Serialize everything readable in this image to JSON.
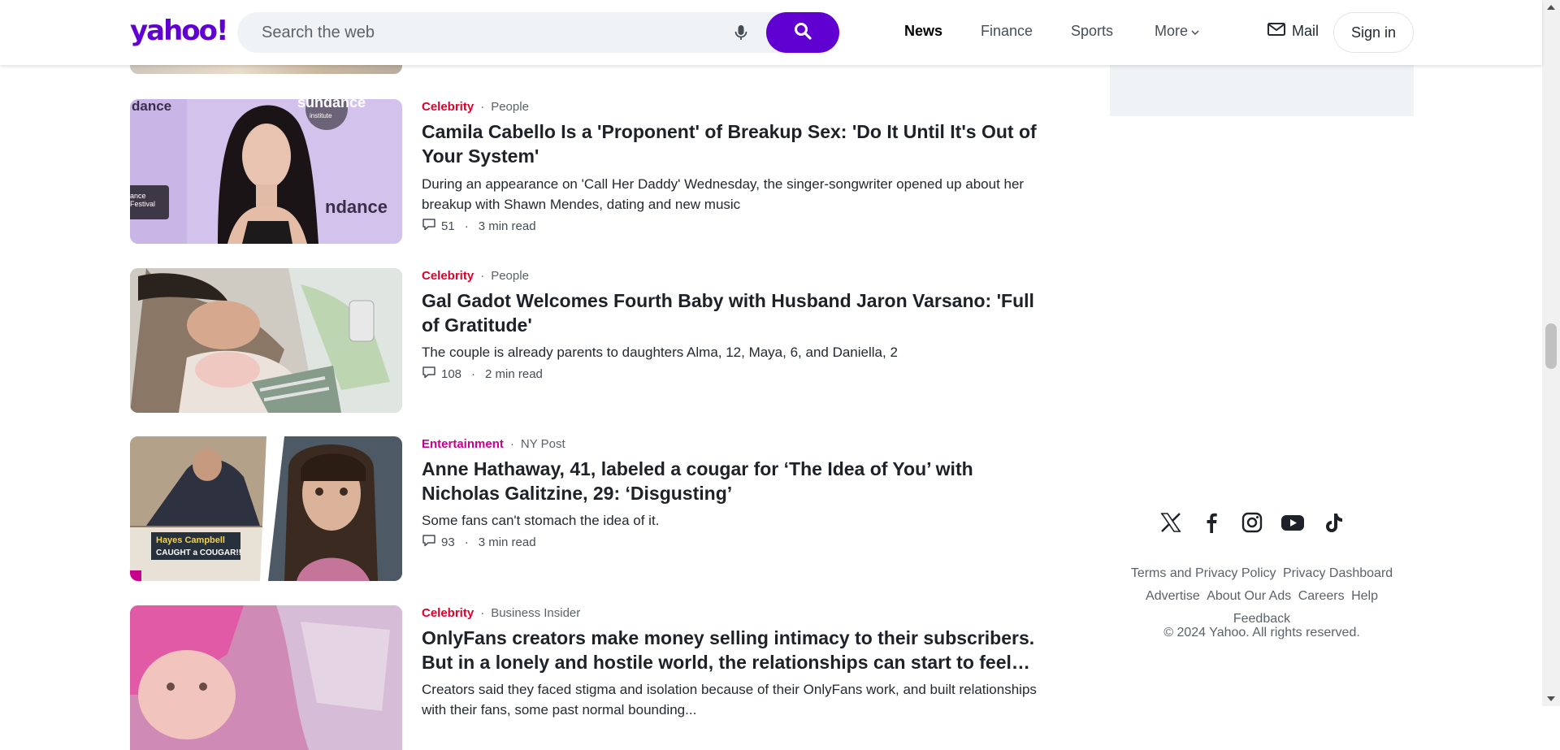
{
  "header": {
    "logo": "yahoo!",
    "search_placeholder": "Search the web",
    "nav": [
      "News",
      "Finance",
      "Sports",
      "More"
    ],
    "mail_label": "Mail",
    "signin_label": "Sign in"
  },
  "stream": [
    {
      "category": "Celebrity",
      "category_color": "#e0002b",
      "source": "People",
      "title": "Camila Cabello Is a 'Proponent' of Breakup Sex: 'Do It Until It's Out of Your System'",
      "summary": "During an appearance on 'Call Her Daddy' Wednesday, the singer-songwriter opened up about her breakup with Shawn Mendes, dating and new music",
      "comments": "51",
      "read_time": "3 min read",
      "thumb_text": [
        "dance",
        "sundance",
        "institute",
        "ance",
        "Festival",
        "ndance"
      ]
    },
    {
      "category": "Celebrity",
      "category_color": "#e0002b",
      "source": "People",
      "title": "Gal Gadot Welcomes Fourth Baby with Husband Jaron Varsano: 'Full of Gratitude'",
      "summary": "The couple is already parents to daughters Alma, 12, Maya, 6, and Daniella, 2",
      "comments": "108",
      "read_time": "2 min read"
    },
    {
      "category": "Entertainment",
      "category_color": "#c7018b",
      "source": "NY Post",
      "title": "Anne Hathaway, 41, labeled a cougar for ‘The Idea of You’ with Nicholas Galitzine, 29: ‘Disgusting’",
      "summary": "Some fans can't stomach the idea of it.",
      "comments": "93",
      "read_time": "3 min read",
      "thumb_text": [
        "Hayes Campbell",
        "CAUGHT a COUGAR!!"
      ]
    },
    {
      "category": "Celebrity",
      "category_color": "#e0002b",
      "source": "Business Insider",
      "title": "OnlyFans creators make money selling intimacy to their subscribers. But in a lonely and hostile world, the relationships can start to feel…",
      "summary": "Creators said they faced stigma and isolation because of their OnlyFans work, and built relationships with their fans, some past normal bounding..."
    }
  ],
  "rail": {
    "social_icons": [
      "x-icon",
      "facebook-icon",
      "instagram-icon",
      "youtube-icon",
      "tiktok-icon"
    ],
    "footer_links": [
      "Terms and Privacy Policy",
      "Privacy Dashboard",
      "Advertise",
      "About Our Ads",
      "Careers",
      "Help",
      "Feedback"
    ],
    "copyright": "© 2024 Yahoo. All rights reserved."
  }
}
